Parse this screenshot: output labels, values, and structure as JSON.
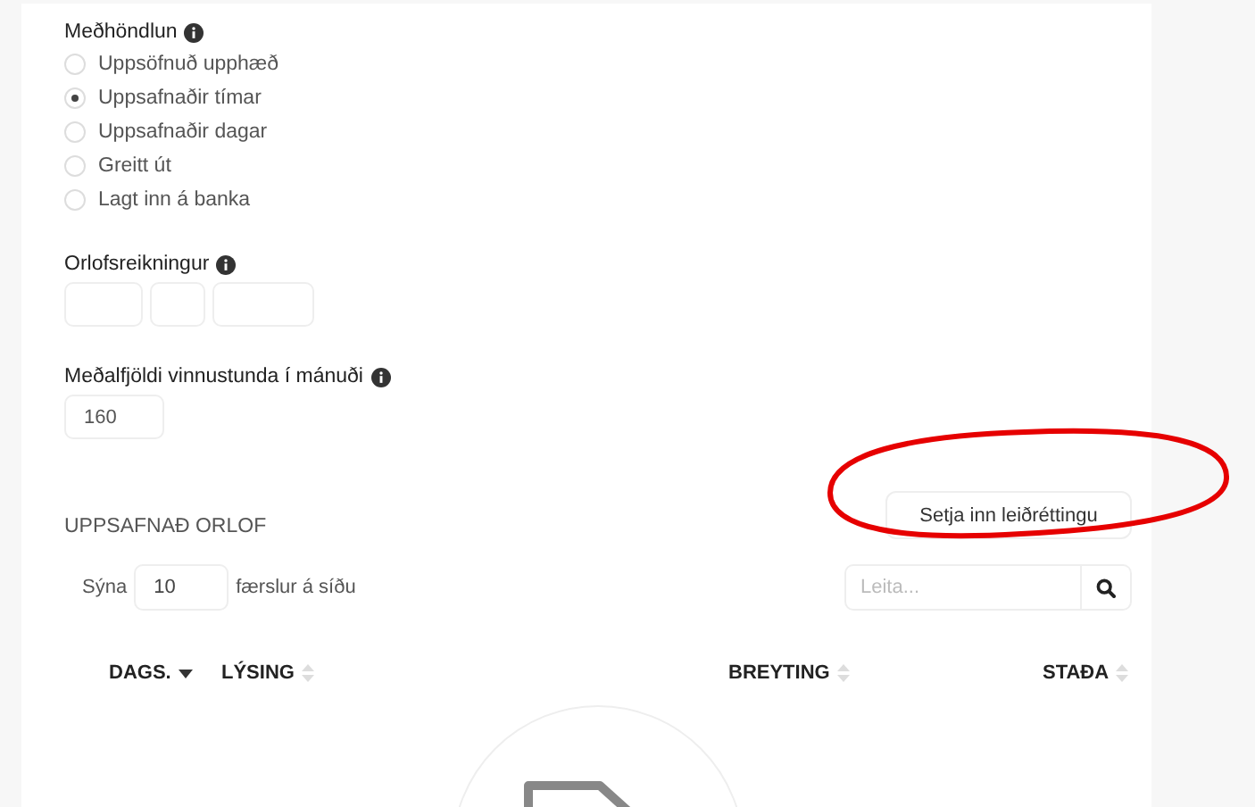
{
  "handling": {
    "label": "Meðhöndlun",
    "options": [
      {
        "label": "Uppsöfnuð upphæð",
        "selected": false
      },
      {
        "label": "Uppsafnaðir tímar",
        "selected": true
      },
      {
        "label": "Uppsafnaðir dagar",
        "selected": false
      },
      {
        "label": "Greitt út",
        "selected": false
      },
      {
        "label": "Lagt inn á banka",
        "selected": false
      }
    ]
  },
  "vacation_account": {
    "label": "Orlofsreikningur"
  },
  "avg_hours": {
    "label": "Meðalfjöldi vinnustunda í mánuði",
    "value": "160"
  },
  "accrued": {
    "title": "UPPSAFNAÐ ORLOF",
    "button": "Setja inn leiðréttingu",
    "show_prefix": "Sýna",
    "page_size": "10",
    "show_suffix": "færslur á síðu",
    "search_placeholder": "Leita...",
    "columns": [
      {
        "label": "DAGS.",
        "sorted": true
      },
      {
        "label": "LÝSING",
        "sorted": false
      },
      {
        "label": "BREYTING",
        "sorted": false
      },
      {
        "label": "STAÐA",
        "sorted": false
      }
    ]
  }
}
